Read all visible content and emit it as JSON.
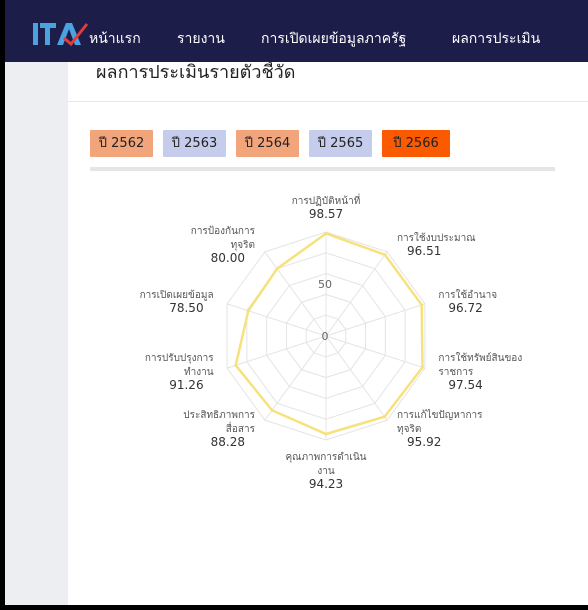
{
  "nav": {
    "logo_alt": "ITA",
    "items": [
      "หน้าแรก",
      "รายงาน",
      "การเปิดเผยข้อมูลภาครัฐ",
      "ผลการประเมิน"
    ]
  },
  "card": {
    "title": "ผลการประเมินรายตัวชี้วัด"
  },
  "year_tabs": [
    {
      "label": "ปี 2562",
      "color": "#f2a57a"
    },
    {
      "label": "ปี 2563",
      "color": "#c6cdec"
    },
    {
      "label": "ปี 2564",
      "color": "#f2a57a"
    },
    {
      "label": "ปี 2565",
      "color": "#c6cdec"
    },
    {
      "label": "ปี 2566",
      "color": "#fc5a00"
    }
  ],
  "chart_data": {
    "type": "radar",
    "r_min": 0,
    "r_max": 100,
    "ticks": [
      0,
      50
    ],
    "series_color": "#f6e27d",
    "axes": [
      {
        "label_lines": [
          "การปฏิบัติหน้าที่"
        ],
        "value": 98.57
      },
      {
        "label_lines": [
          "การใช้งบประมาณ"
        ],
        "value": 96.51
      },
      {
        "label_lines": [
          "การใช้อำนาจ"
        ],
        "value": 96.72
      },
      {
        "label_lines": [
          "การใช้ทรัพย์สินของ",
          "ราชการ"
        ],
        "value": 97.54
      },
      {
        "label_lines": [
          "การแก้ไขปัญหาการ",
          "ทุจริต"
        ],
        "value": 95.92
      },
      {
        "label_lines": [
          "คุณภาพการดำเนิน",
          "งาน"
        ],
        "value": 94.23
      },
      {
        "label_lines": [
          "ประสิทธิภาพการ",
          "สื่อสาร"
        ],
        "value": 88.28
      },
      {
        "label_lines": [
          "การปรับปรุงการ",
          "ทำงาน"
        ],
        "value": 91.26
      },
      {
        "label_lines": [
          "การเปิดเผยข้อมูล"
        ],
        "value": 78.5
      },
      {
        "label_lines": [
          "การป้องกันการ",
          "ทุจริต"
        ],
        "value": 80.0
      }
    ],
    "value_labels": [
      "98.57",
      "96.51",
      "96.72",
      "97.54",
      "95.92",
      "94.23",
      "88.28",
      "91.26",
      "78.50",
      "80.00"
    ]
  }
}
